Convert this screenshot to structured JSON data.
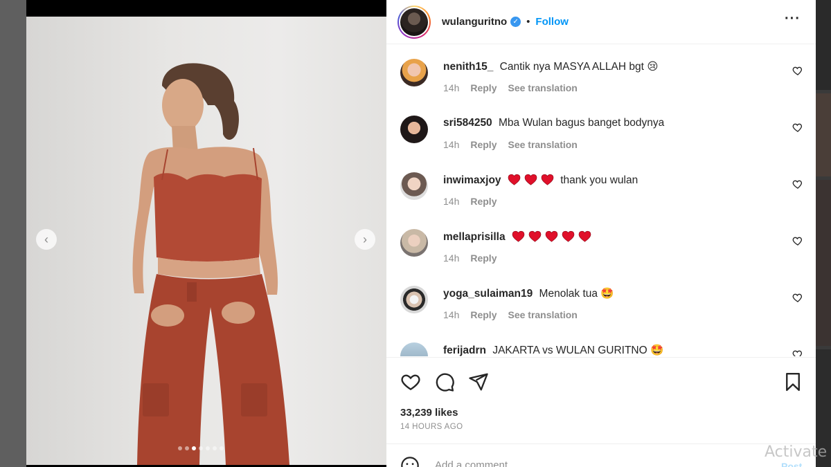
{
  "post": {
    "username": "wulanguritno",
    "separator": "•",
    "follow_label": "Follow",
    "more_label": "···",
    "verified_mark": "✓"
  },
  "media": {
    "prev_icon": "‹",
    "next_icon": "›",
    "dot_count": 7,
    "active_dot": 3
  },
  "comments": [
    {
      "user": "nenith15_",
      "text": "Cantik nya MASYA ALLAH bgt",
      "emoji": "😢",
      "time": "14h",
      "reply": "Reply",
      "translate": "See translation"
    },
    {
      "user": "sri584250",
      "text": "Mba Wulan bagus banget bodynya",
      "emoji": "",
      "time": "14h",
      "reply": "Reply",
      "translate": "See translation"
    },
    {
      "user": "inwimaxjoy",
      "hearts": 3,
      "text": "thank you wulan",
      "emoji": "",
      "time": "14h",
      "reply": "Reply",
      "translate": ""
    },
    {
      "user": "mellaprisilla",
      "hearts": 5,
      "text": "",
      "emoji": "",
      "time": "14h",
      "reply": "Reply",
      "translate": ""
    },
    {
      "user": "yoga_sulaiman19",
      "text": "Menolak tua",
      "emoji": "🤩",
      "time": "14h",
      "reply": "Reply",
      "translate": "See translation"
    },
    {
      "user": "ferijadrn",
      "text": "JAKARTA vs WULAN GURITNO",
      "emoji": "🤩",
      "time": "",
      "reply": "",
      "translate": ""
    }
  ],
  "stats": {
    "likes": "33,239 likes",
    "posted": "14 HOURS AGO"
  },
  "add_comment": {
    "placeholder": "Add a comment...",
    "post_label": "Post"
  },
  "watermark": "Activate",
  "colors": {
    "accent": "#0095f6",
    "verified": "#3897f0",
    "heart_emoji": "#e0102a"
  },
  "icons": [
    "heart-icon",
    "comment-icon",
    "share-icon",
    "bookmark-icon",
    "emoji-icon",
    "more-icon",
    "chevron-left-icon",
    "chevron-right-icon"
  ]
}
